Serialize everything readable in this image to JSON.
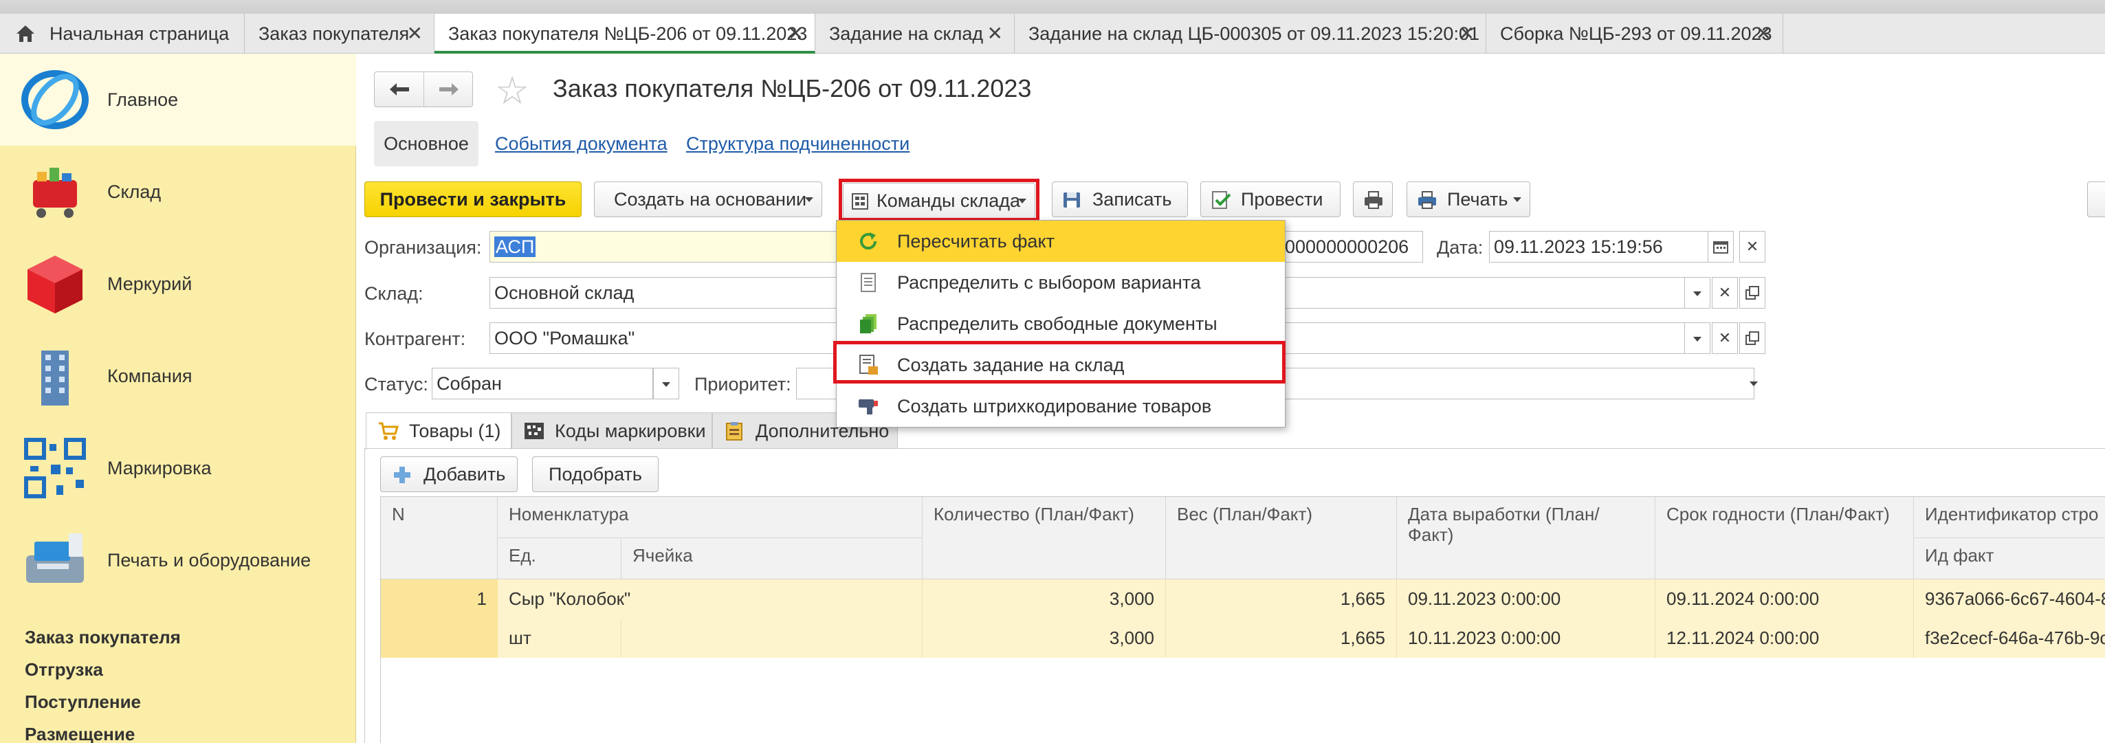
{
  "tabs": [
    {
      "label": "Начальная страница",
      "closable": false,
      "icon": "home-icon"
    },
    {
      "label": "Заказ покупателя",
      "closable": true
    },
    {
      "label": "Заказ покупателя №ЦБ-206 от 09.11.2023",
      "closable": true,
      "active": true
    },
    {
      "label": "Задание на склад",
      "closable": true
    },
    {
      "label": "Задание на склад ЦБ-000305 от 09.11.2023 15:20:01",
      "closable": true
    },
    {
      "label": "Сборка №ЦБ-293 от 09.11.2023",
      "closable": true
    }
  ],
  "close_glyph": "✕",
  "sidebar": {
    "sections": [
      {
        "label": "Главное",
        "icon": "main-logo-icon",
        "active": true
      },
      {
        "label": "Склад",
        "icon": "warehouse-cart-icon"
      },
      {
        "label": "Меркурий",
        "icon": "mercury-cube-icon"
      },
      {
        "label": "Компания",
        "icon": "building-icon"
      },
      {
        "label": "Маркировка",
        "icon": "qr-code-icon"
      },
      {
        "label": "Печать и оборудование",
        "icon": "pos-terminal-icon"
      }
    ],
    "links": [
      "Заказ покупателя",
      "Отгрузка",
      "Поступление",
      "Размещение"
    ]
  },
  "header": {
    "title": "Заказ покупателя №ЦБ-206 от 09.11.2023",
    "subtabs": {
      "main": "Основное",
      "events": "События документа",
      "structure": "Структура подчиненности"
    }
  },
  "toolbar": {
    "post_close": "Провести и закрыть",
    "create_based": "Создать на основании",
    "warehouse_commands": "Команды склада",
    "save": "Записать",
    "post": "Провести",
    "print": "Печать"
  },
  "form": {
    "org_label": "Организация:",
    "org_value": "АСП",
    "number_value": "000000000206",
    "date_label": "Дата:",
    "date_value": "09.11.2023 15:19:56",
    "warehouse_label": "Склад:",
    "warehouse_value": "Основной склад",
    "counterparty_label": "Контрагент:",
    "counterparty_value": "ООО \"Ромашка\"",
    "status_label": "Статус:",
    "status_value": "Собран",
    "priority_label": "Приоритет:"
  },
  "inner_tabs": {
    "goods": "Товары (1)",
    "codes": "Коды маркировки",
    "extra": "Дополнительно"
  },
  "table_toolbar": {
    "add": "Добавить",
    "pick": "Подобрать"
  },
  "table": {
    "headers": {
      "n": "N",
      "nomenclature": "Номенклатура",
      "unit": "Ед.",
      "cell": "Ячейка",
      "quantity": "Количество (План/Факт)",
      "weight": "Вес (План/Факт)",
      "production_date": "Дата выработки (План/Факт)",
      "expiry": "Срок годности (План/Факт)",
      "identifier": "Идентификатор стро",
      "id_fact": "Ид факт"
    },
    "rows": [
      {
        "n": "1",
        "name": "Сыр \"Колобок\"",
        "unit": "шт",
        "qty_plan": "3,000",
        "qty_fact": "3,000",
        "weight_plan": "1,665",
        "weight_fact": "1,665",
        "prod_plan": "09.11.2023 0:00:00",
        "prod_fact": "10.11.2023 0:00:00",
        "exp_plan": "09.11.2024 0:00:00",
        "exp_fact": "12.11.2024 0:00:00",
        "id_plan": "9367a066-6c67-4604-8",
        "id_fact": "f3e2cecf-646a-476b-9c"
      }
    ]
  },
  "dropdown": {
    "items": [
      {
        "label": "Пересчитать факт",
        "icon": "refresh-icon",
        "highlighted": true
      },
      {
        "label": "Распределить с выбором варианта",
        "icon": "document-list-icon"
      },
      {
        "label": "Распределить свободные документы",
        "icon": "documents-stack-icon"
      },
      {
        "label": "Создать задание на склад",
        "icon": "warehouse-task-icon",
        "outlined": true
      },
      {
        "label": "Создать штрихкодирование товаров",
        "icon": "barcode-scanner-icon"
      }
    ]
  },
  "colors": {
    "accent_yellow": "#f6d200",
    "highlight_red": "#e0161e",
    "link_blue": "#1f5ba8",
    "sidebar_bg": "#fbeea8"
  }
}
